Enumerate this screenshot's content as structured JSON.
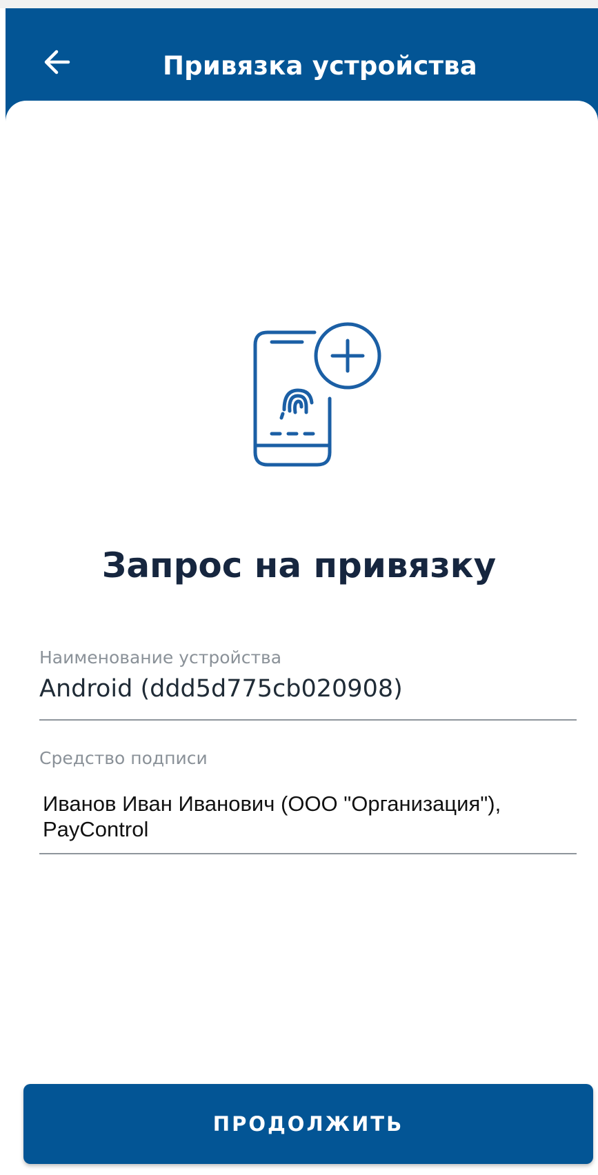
{
  "header": {
    "title": "Привязка устройства",
    "back_icon": "arrow-left-icon"
  },
  "illustration": {
    "icon": "phone-fingerprint-add-icon"
  },
  "main": {
    "title": "Запрос на привязку",
    "device_name": {
      "label": "Наименование устройства",
      "value": "Android (ddd5d775cb020908)"
    },
    "signature_tool": {
      "label": "Средство подписи",
      "value_line1": "Иванов Иван Иванович (ООО \"Организация\"),",
      "value_line2": "PayControl"
    }
  },
  "footer": {
    "continue_label": "ПРОДОЛЖИТЬ"
  },
  "colors": {
    "primary": "#035595",
    "title_text": "#16263f",
    "label_text": "#8a9198",
    "icon_stroke": "#1b5fa5"
  }
}
